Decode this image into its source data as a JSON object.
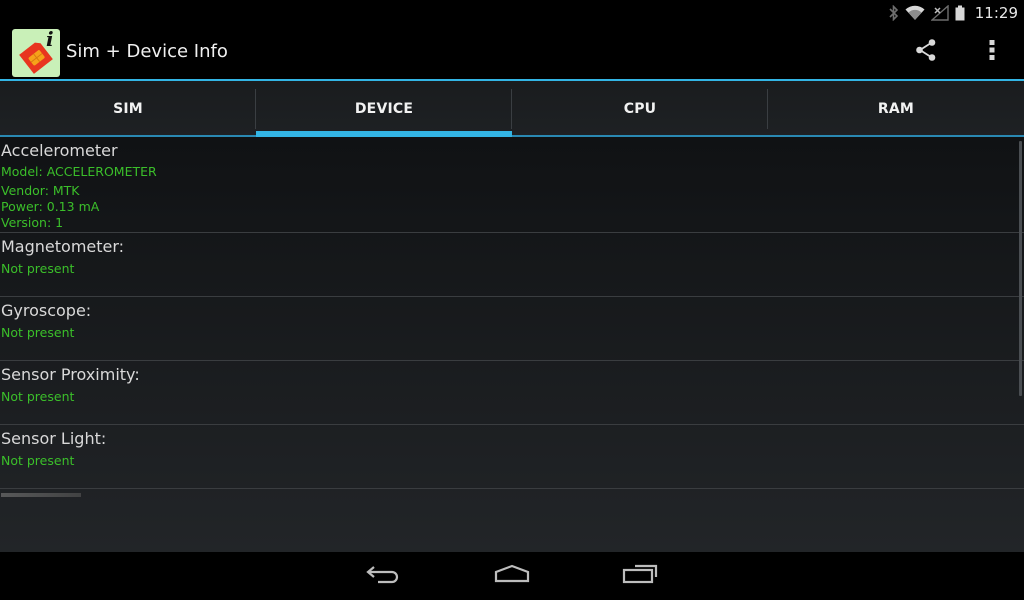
{
  "status_bar": {
    "time": "11:29",
    "icons": [
      "bluetooth-icon",
      "wifi-icon",
      "signal-no-service-icon",
      "battery-icon"
    ]
  },
  "action_bar": {
    "app_title": "Sim + Device Info",
    "app_icon": "sim-card-info-icon",
    "actions": [
      "share-icon",
      "overflow-menu-icon"
    ]
  },
  "tabs": [
    {
      "label": "SIM",
      "selected": false
    },
    {
      "label": "DEVICE",
      "selected": true
    },
    {
      "label": "CPU",
      "selected": false
    },
    {
      "label": "RAM",
      "selected": false
    }
  ],
  "sensors": [
    {
      "title": "Accelerometer",
      "lines": [
        "Model: ACCELEROMETER",
        "Vendor: MTK",
        "Power: 0.13 mA",
        "Version: 1"
      ]
    },
    {
      "title": "Magnetometer:",
      "lines": [
        "Not present"
      ]
    },
    {
      "title": "Gyroscope:",
      "lines": [
        "Not present"
      ]
    },
    {
      "title": "Sensor Proximity:",
      "lines": [
        "Not present"
      ]
    },
    {
      "title": "Sensor Light:",
      "lines": [
        "Not present"
      ]
    }
  ],
  "colors": {
    "accent": "#33b5e5",
    "value_green": "#3bbf2a",
    "app_icon_bg": "#c9f0b8",
    "sim_red": "#e8351f",
    "sim_orange": "#f6a11a"
  },
  "nav_bar": [
    "back-icon",
    "home-icon",
    "recent-apps-icon"
  ]
}
